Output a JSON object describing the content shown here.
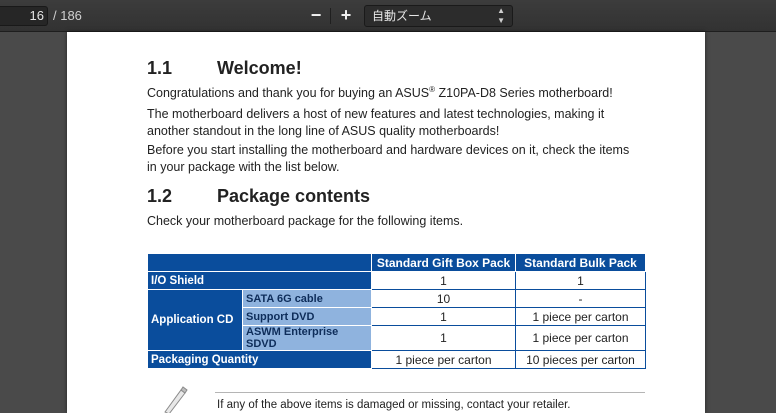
{
  "toolbar": {
    "page_current": "16",
    "page_total": "/ 186",
    "zoom_out_label": "−",
    "zoom_in_label": "+",
    "zoom_value": "自動ズーム"
  },
  "document": {
    "section1_number": "1.1",
    "section1_title": "Welcome!",
    "para1_a": "Congratulations and thank you for buying an ASUS",
    "para1_sup": "®",
    "para1_b": " Z10PA-D8 Series motherboard!",
    "para2": "The motherboard delivers a host of new features and latest technologies, making it another standout in the long line of ASUS quality motherboards!",
    "para3": "Before you start installing the motherboard and hardware devices on it, check the items in your package with the list below.",
    "section2_number": "1.2",
    "section2_title": "Package contents",
    "para4": "Check your motherboard package for the following items.",
    "table": {
      "col_gift": "Standard Gift Box Pack",
      "col_bulk": "Standard Bulk Pack",
      "io_label": "I/O Shield",
      "io_gift": "1",
      "io_bulk": "1",
      "app_label": "Application CD",
      "sata_label": "SATA 6G cable",
      "sata_gift": "10",
      "sata_bulk": "-",
      "dvd_label": "Support DVD",
      "dvd_gift": "1",
      "dvd_bulk": "1 piece per carton",
      "asmw_label": "ASWM Enterprise SDVD",
      "asmw_gift": "1",
      "asmw_bulk": "1 piece per carton",
      "qty_label": "Packaging Quantity",
      "qty_gift": "1 piece per carton",
      "qty_bulk": "10 pieces per carton"
    },
    "note": "If any of the above items is damaged or missing, contact your retailer."
  }
}
